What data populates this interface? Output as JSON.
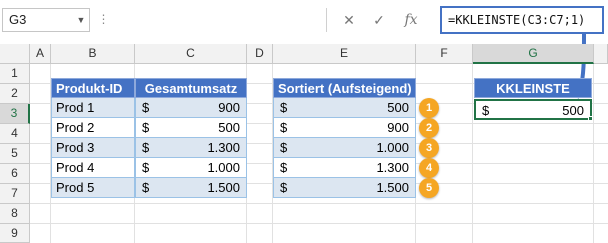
{
  "formula_bar": {
    "name_box": "G3",
    "cancel_icon": "✕",
    "enter_icon": "✓",
    "fx_label": "fx",
    "formula": "=KKLEINSTE(C3:C7;1)"
  },
  "columns": [
    "A",
    "B",
    "C",
    "D",
    "E",
    "F",
    "G"
  ],
  "rows": [
    "1",
    "2",
    "3",
    "4",
    "5",
    "6",
    "7",
    "8",
    "9",
    "10"
  ],
  "table1": {
    "headers": [
      "Produkt-ID",
      "Gesamtumsatz"
    ],
    "rows": [
      {
        "id": "Prod 1",
        "cur": "$",
        "value": "900"
      },
      {
        "id": "Prod 2",
        "cur": "$",
        "value": "500"
      },
      {
        "id": "Prod 3",
        "cur": "$",
        "value": "1.300"
      },
      {
        "id": "Prod 4",
        "cur": "$",
        "value": "1.000"
      },
      {
        "id": "Prod 5",
        "cur": "$",
        "value": "1.500"
      }
    ]
  },
  "table2": {
    "header": "Sortiert (Aufsteigend)",
    "rows": [
      {
        "cur": "$",
        "value": "500"
      },
      {
        "cur": "$",
        "value": "900"
      },
      {
        "cur": "$",
        "value": "1.000"
      },
      {
        "cur": "$",
        "value": "1.300"
      },
      {
        "cur": "$",
        "value": "1.500"
      }
    ],
    "badges": [
      "1",
      "2",
      "3",
      "4",
      "5"
    ]
  },
  "result": {
    "header": "KKLEINSTE",
    "cur": "$",
    "value": "500"
  },
  "colors": {
    "header_blue": "#4472c4",
    "band_blue": "#dce6f1",
    "badge_orange": "#f5a623",
    "excel_green": "#217346"
  }
}
